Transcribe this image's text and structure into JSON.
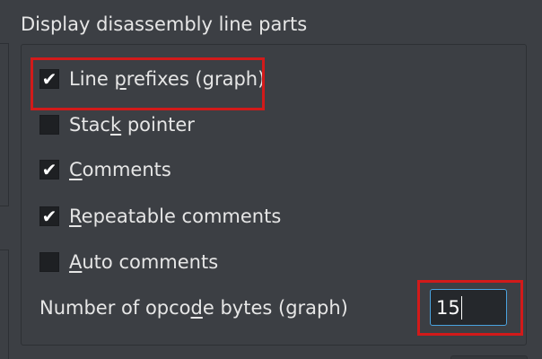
{
  "group": {
    "title": "Display disassembly line parts"
  },
  "options": [
    {
      "pre": "Line ",
      "mnemonic": "p",
      "post": "refixes (graph)",
      "checked": true
    },
    {
      "pre": "Stac",
      "mnemonic": "k",
      "post": " pointer",
      "checked": false
    },
    {
      "pre": "",
      "mnemonic": "C",
      "post": "omments",
      "checked": true
    },
    {
      "pre": "",
      "mnemonic": "R",
      "post": "epeatable comments",
      "checked": true
    },
    {
      "pre": "",
      "mnemonic": "A",
      "post": "uto comments",
      "checked": false
    }
  ],
  "opcode": {
    "label_pre": "Number of opco",
    "label_mnemonic": "d",
    "label_post": "e bytes (graph)",
    "value": "15"
  },
  "check_glyph": "✔",
  "colors": {
    "highlight": "#d21a1a",
    "focus": "#4aa3df",
    "background": "#3c3f44"
  }
}
